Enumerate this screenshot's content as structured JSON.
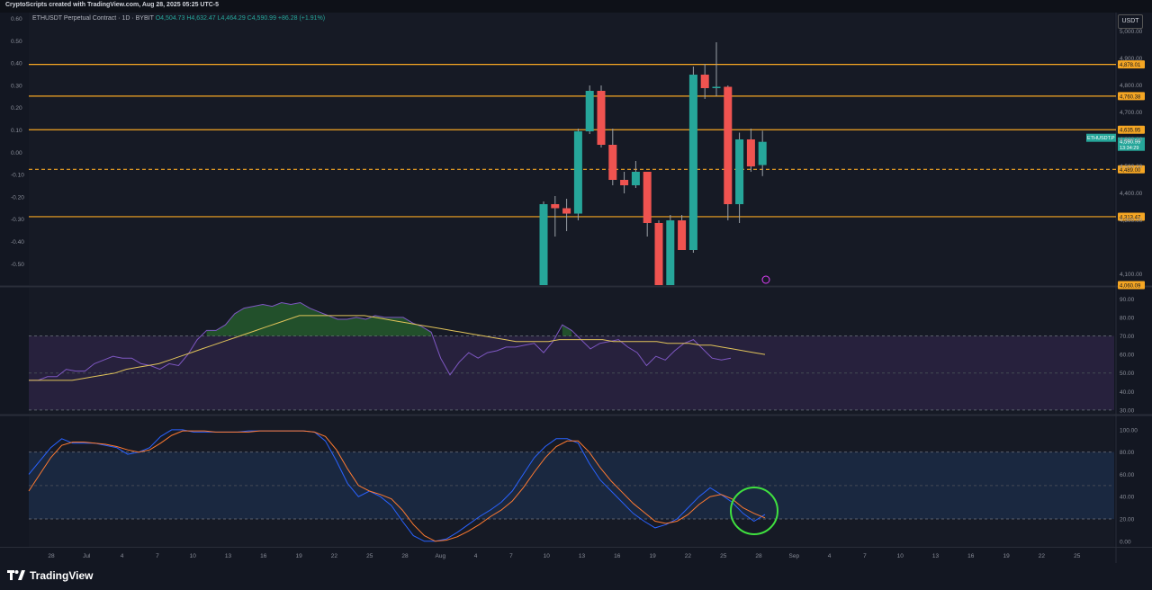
{
  "credit": "CryptoScripts created with TradingView.com, Aug 28, 2025 05:25 UTC-5",
  "legend": {
    "symbol": "ETHUSDT Perpetual Contract · 1D · BYBIT",
    "ohlc": "O4,504.73  H4,632.47  L4,464.29  C4,590.99  +86.28 (+1.91%)"
  },
  "currency_button": "USDT",
  "brand": "TradingView",
  "colors": {
    "up": "#26a69a",
    "down": "#ef5350",
    "level": "#f5a623",
    "rsi": "#7e57c2",
    "rsi_ma": "#e0c35a",
    "stoch_k": "#2962ff",
    "stoch_d": "#ff7a30",
    "highlight": "#3fe03f"
  },
  "chart_data": [
    {
      "type": "candlestick",
      "pane": "price",
      "left_axis_ticks": [
        "0.60",
        "0.50",
        "0.40",
        "0.30",
        "0.20",
        "0.10",
        "0.00",
        "-0.10",
        "-0.20",
        "-0.30",
        "-0.40",
        "-0.50"
      ],
      "right_axis_ticks": [
        "5,000.00",
        "4,900.00",
        "4,800.00",
        "4,700.00",
        "4,600.00",
        "4,500.00",
        "4,400.00",
        "4,300.00",
        "4,100.00"
      ],
      "ylim": [
        4060,
        5070
      ],
      "candles": [
        {
          "date": "Aug 8",
          "o": 4060,
          "h": 4370,
          "l": 4060,
          "c": 4360
        },
        {
          "date": "Aug 9",
          "o": 4360,
          "h": 4390,
          "l": 4240,
          "c": 4345
        },
        {
          "date": "Aug 10",
          "o": 4345,
          "h": 4380,
          "l": 4260,
          "c": 4325
        },
        {
          "date": "Aug 11",
          "o": 4325,
          "h": 4640,
          "l": 4300,
          "c": 4630
        },
        {
          "date": "Aug 12",
          "o": 4630,
          "h": 4800,
          "l": 4620,
          "c": 4780
        },
        {
          "date": "Aug 13",
          "o": 4780,
          "h": 4800,
          "l": 4570,
          "c": 4580
        },
        {
          "date": "Aug 14",
          "o": 4580,
          "h": 4640,
          "l": 4430,
          "c": 4450
        },
        {
          "date": "Aug 15",
          "o": 4450,
          "h": 4480,
          "l": 4400,
          "c": 4430
        },
        {
          "date": "Aug 16",
          "o": 4430,
          "h": 4520,
          "l": 4420,
          "c": 4480
        },
        {
          "date": "Aug 17",
          "o": 4480,
          "h": 4480,
          "l": 4240,
          "c": 4290
        },
        {
          "date": "Aug 18",
          "o": 4290,
          "h": 4300,
          "l": 4060,
          "c": 4060
        },
        {
          "date": "Aug 19",
          "o": 4060,
          "h": 4320,
          "l": 4060,
          "c": 4300
        },
        {
          "date": "Aug 20",
          "o": 4300,
          "h": 4320,
          "l": 4200,
          "c": 4190
        },
        {
          "date": "Aug 21",
          "o": 4190,
          "h": 4870,
          "l": 4180,
          "c": 4840
        },
        {
          "date": "Aug 22",
          "o": 4840,
          "h": 4880,
          "l": 4750,
          "c": 4790
        },
        {
          "date": "Aug 23",
          "o": 4790,
          "h": 4960,
          "l": 4760,
          "c": 4795
        },
        {
          "date": "Aug 24",
          "o": 4795,
          "h": 4800,
          "l": 4300,
          "c": 4360
        },
        {
          "date": "Aug 25",
          "o": 4360,
          "h": 4625,
          "l": 4290,
          "c": 4600
        },
        {
          "date": "Aug 26",
          "o": 4600,
          "h": 4640,
          "l": 4480,
          "c": 4500
        },
        {
          "date": "Aug 27",
          "o": 4505,
          "h": 4632,
          "l": 4464,
          "c": 4591
        }
      ],
      "levels": [
        {
          "value": "4,878.01",
          "style": "solid"
        },
        {
          "value": "4,760.38",
          "style": "solid"
        },
        {
          "value": "4,635.95",
          "style": "solid"
        },
        {
          "value": "4,489.00",
          "style": "dashed"
        },
        {
          "value": "4,313.47",
          "style": "solid"
        },
        {
          "value": "4,060.09",
          "style": "none"
        }
      ],
      "last_price": {
        "ticker": "ETHUSDT.P",
        "price": "4,590.99",
        "countdown": "13:34:29"
      }
    },
    {
      "type": "line",
      "pane": "rsi",
      "ticks": [
        "90.00",
        "80.00",
        "70.00",
        "60.00",
        "50.00",
        "40.00",
        "30.00"
      ],
      "ylim": [
        28,
        96
      ],
      "bands": {
        "upper": 70,
        "lower": 30
      },
      "series": [
        {
          "values": [
            46,
            46,
            48,
            48,
            52,
            51,
            51,
            55,
            57,
            59,
            58,
            58,
            55,
            54,
            52,
            55,
            54,
            60,
            68,
            73,
            73,
            76,
            82,
            85,
            86,
            87,
            86,
            88,
            87,
            88,
            85,
            83,
            81,
            79,
            79,
            80,
            79,
            81,
            80,
            80,
            80,
            77,
            75,
            72,
            58,
            49,
            56,
            61,
            58,
            61,
            62,
            64,
            64,
            65,
            66,
            61,
            67,
            76,
            73,
            68,
            63,
            66,
            67,
            68,
            64,
            61,
            54,
            59,
            57,
            62,
            66,
            68,
            63,
            58,
            57,
            58
          ]
        },
        {
          "values": [
            46,
            46,
            46,
            46,
            46,
            47,
            48,
            49,
            50,
            52,
            53,
            54,
            55,
            57,
            59,
            61,
            63,
            65,
            67,
            69,
            71,
            73,
            75,
            77,
            79,
            81,
            81,
            81,
            81,
            81,
            81,
            81,
            80,
            79,
            78,
            77,
            76,
            75,
            74,
            73,
            72,
            71,
            70,
            69,
            68,
            67,
            67,
            67,
            67,
            68,
            68,
            68,
            68,
            68,
            67,
            67,
            67,
            67,
            67,
            66,
            66,
            66,
            65,
            65,
            64,
            63,
            62,
            61,
            60
          ]
        }
      ]
    },
    {
      "type": "line",
      "pane": "stochastic",
      "ticks": [
        "100.00",
        "80.00",
        "60.00",
        "40.00",
        "20.00",
        "0.00"
      ],
      "ylim": [
        -5,
        112
      ],
      "bands": {
        "upper": 80,
        "lower": 20
      },
      "series": [
        {
          "values": [
            60,
            72,
            84,
            92,
            88,
            88,
            88,
            86,
            84,
            78,
            80,
            84,
            94,
            100,
            100,
            98,
            98,
            98,
            98,
            98,
            99,
            99,
            99,
            99,
            99,
            99,
            98,
            90,
            72,
            52,
            40,
            45,
            40,
            32,
            18,
            5,
            0,
            0,
            2,
            8,
            15,
            22,
            28,
            35,
            45,
            60,
            75,
            85,
            92,
            92,
            88,
            70,
            55,
            45,
            35,
            25,
            18,
            12,
            15,
            20,
            30,
            40,
            48,
            42,
            35,
            25,
            18,
            24
          ]
        },
        {
          "values": [
            45,
            60,
            75,
            86,
            89,
            89,
            88,
            87,
            85,
            82,
            80,
            82,
            88,
            95,
            99,
            99,
            99,
            98,
            98,
            98,
            98,
            99,
            99,
            99,
            99,
            99,
            98,
            94,
            82,
            65,
            50,
            45,
            42,
            38,
            28,
            15,
            5,
            0,
            1,
            4,
            9,
            15,
            22,
            28,
            36,
            48,
            62,
            75,
            85,
            90,
            90,
            80,
            66,
            54,
            44,
            34,
            26,
            18,
            16,
            18,
            24,
            33,
            40,
            42,
            38,
            30,
            25,
            21
          ]
        }
      ]
    }
  ],
  "x_ticks": [
    "28",
    "Jul",
    "4",
    "7",
    "10",
    "13",
    "16",
    "19",
    "22",
    "25",
    "28",
    "Aug",
    "4",
    "7",
    "10",
    "13",
    "16",
    "19",
    "22",
    "25",
    "28",
    "Sep",
    "4",
    "7",
    "10",
    "13",
    "16",
    "19",
    "22",
    "25"
  ]
}
